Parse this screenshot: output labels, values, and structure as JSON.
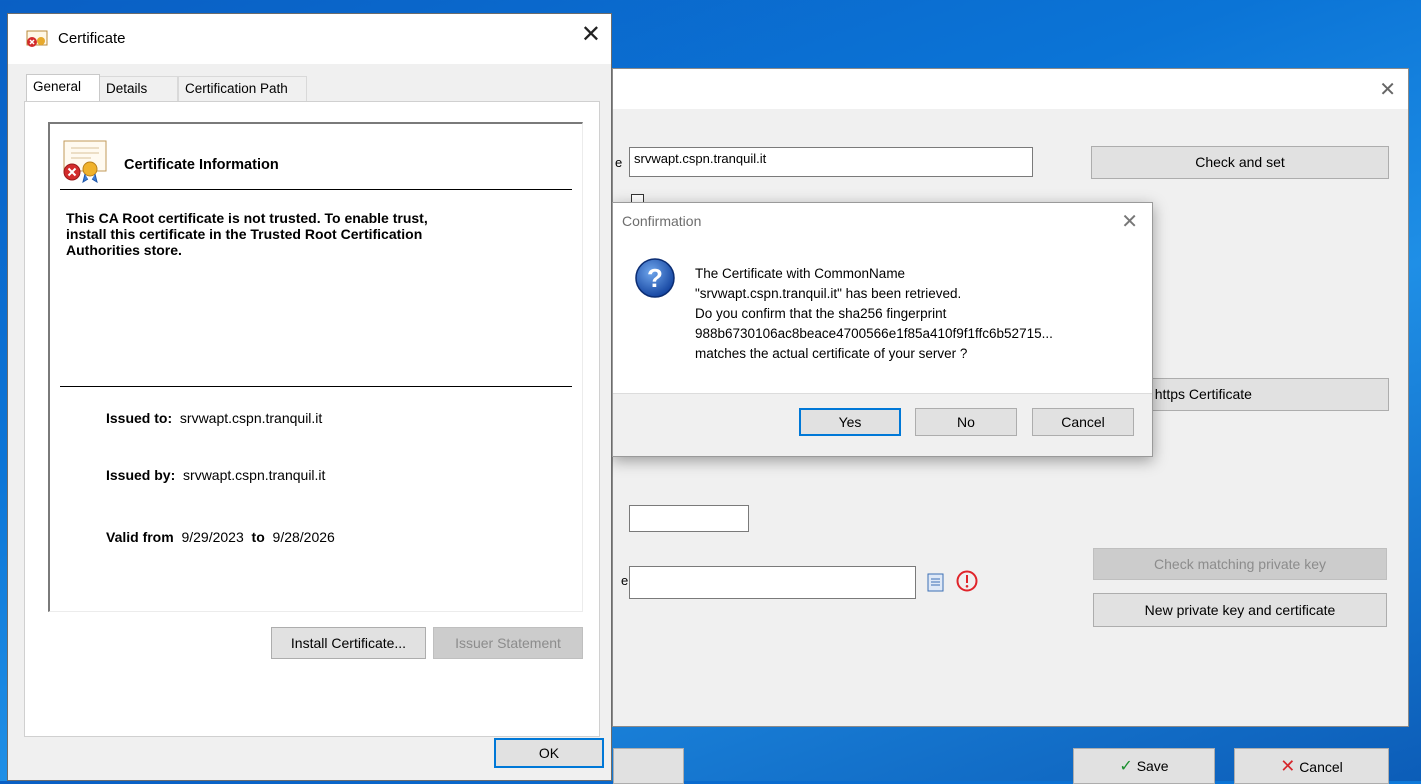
{
  "bg_window": {
    "server_value": "srvwapt.cspn.tranquil.it",
    "check_and_set": "Check and set",
    "get_https_cert": "et Server https Certificate",
    "check_private_key": "Check matching private key",
    "new_private_key": "New  private key and certificate",
    "save": "Save",
    "cancel": "Cancel",
    "save_icon": "checkmark-icon",
    "cancel_icon": "x-icon",
    "error_icon": "exclamation-circle-icon"
  },
  "confirm": {
    "title": "Confirmation",
    "message": "The Certificate with CommonName\n\"srvwapt.cspn.tranquil.it\" has been retrieved.\nDo you confirm that the sha256 fingerprint\n988b6730106ac8beace4700566e1f85a410f9f1ffc6b52715...\nmatches the actual certificate of your server ?",
    "yes": "Yes",
    "no": "No",
    "cancel": "Cancel",
    "icon": "question-icon"
  },
  "cert": {
    "title": "Certificate",
    "tabs": [
      "General",
      "Details",
      "Certification Path"
    ],
    "heading": "Certificate Information",
    "warning": "This CA Root certificate is not trusted. To enable trust,\ninstall this certificate in the Trusted Root Certification\nAuthorities store.",
    "issued_to_label": "Issued to:",
    "issued_to": "srvwapt.cspn.tranquil.it",
    "issued_by_label": "Issued by:",
    "issued_by": "srvwapt.cspn.tranquil.it",
    "valid_from_label": "Valid from",
    "valid_from": "9/29/2023",
    "to_label": "to",
    "valid_to": "9/28/2026",
    "install_btn": "Install Certificate...",
    "issuer_btn": "Issuer Statement",
    "ok_btn": "OK"
  }
}
